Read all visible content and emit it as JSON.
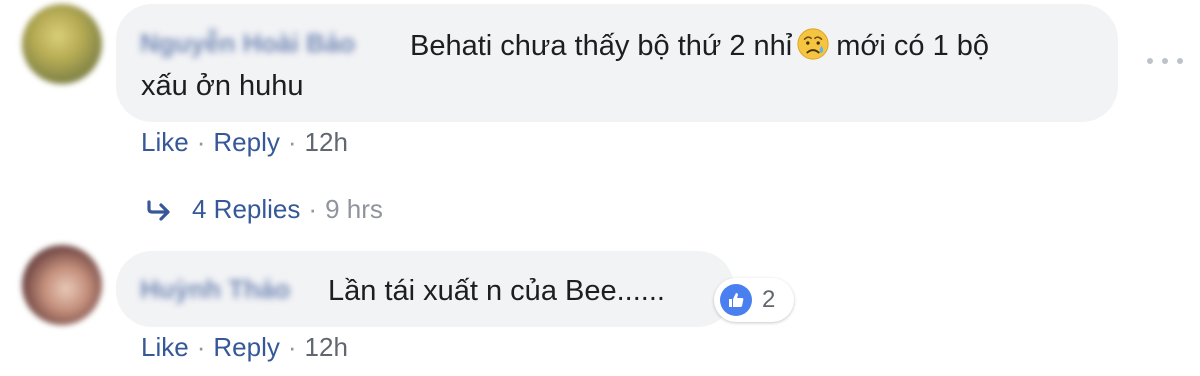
{
  "comments": [
    {
      "author": "Nguyễn Hoài Bảo",
      "text_line1": "Behati chưa thấy bộ thứ 2 nhỉ",
      "text_line1_after_emoji": "mới có 1 bộ",
      "text_line2": "xấu ởn huhu",
      "emoji": "crying-face-emoji",
      "actions": {
        "like": "Like",
        "reply": "Reply",
        "time": "12h",
        "separator": "·"
      },
      "replies": {
        "label": "4 Replies",
        "time": "9 hrs",
        "separator": "·"
      }
    },
    {
      "author": "Huỳnh Thảo",
      "text": "Lần tái xuất n của Bee......",
      "reaction": {
        "icon": "like-icon",
        "count": "2",
        "color": "#4a7ff0"
      },
      "actions": {
        "like": "Like",
        "reply": "Reply",
        "time": "12h",
        "separator": "·"
      }
    }
  ],
  "colors": {
    "link": "#365899",
    "bubble": "#f2f3f5",
    "meta": "#90949c"
  }
}
